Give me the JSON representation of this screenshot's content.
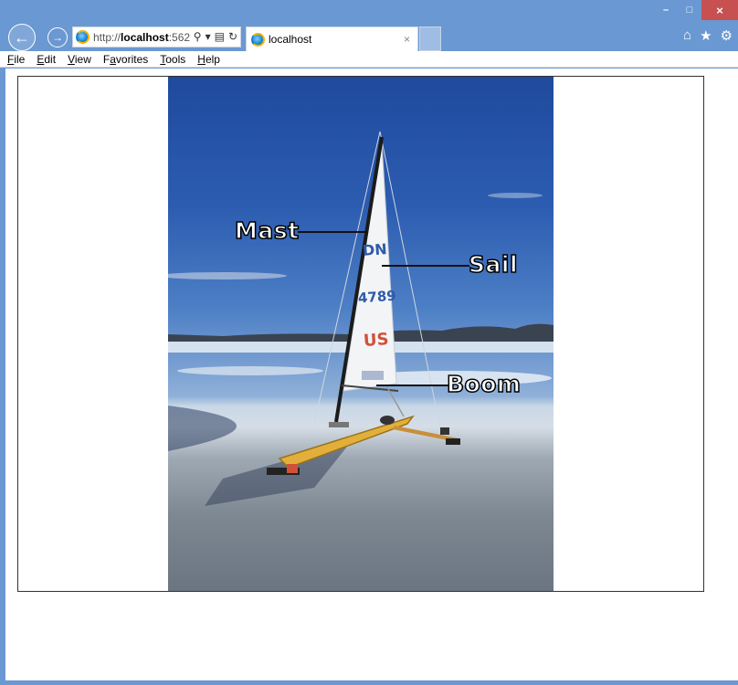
{
  "window": {
    "minimize_glyph": "–",
    "maximize_glyph": "□",
    "close_glyph": "×"
  },
  "toolbar": {
    "back_glyph": "←",
    "forward_glyph": "→",
    "address": {
      "scheme": "http://",
      "host": "localhost",
      "port_fragment": ":562",
      "search_glyph": "⚲",
      "dropdown_glyph": "▾",
      "compat_glyph": "▤",
      "refresh_glyph": "↻"
    },
    "tab": {
      "title": "localhost",
      "close_glyph": "×"
    },
    "home_glyph": "⌂",
    "favorites_glyph": "★",
    "tools_glyph": "⚙"
  },
  "menu": {
    "items": [
      {
        "label": "File",
        "accel": "F",
        "rest": "ile"
      },
      {
        "label": "Edit",
        "accel": "E",
        "rest": "dit"
      },
      {
        "label": "View",
        "accel": "V",
        "rest": "iew"
      },
      {
        "label": "Favorites",
        "accel": "a",
        "pre": "F",
        "rest": "vorites"
      },
      {
        "label": "Tools",
        "accel": "T",
        "rest": "ools"
      },
      {
        "label": "Help",
        "accel": "H",
        "rest": "elp"
      }
    ]
  },
  "figure": {
    "labels": {
      "mast": "Mast",
      "sail": "Sail",
      "boom": "Boom"
    },
    "sail_text": [
      "DN",
      "4789",
      "US"
    ],
    "colors": {
      "sky": "#2c5cb0",
      "ice": "#7d8893",
      "hull": "#e2b03a",
      "sail": "#f2f4f6"
    }
  }
}
